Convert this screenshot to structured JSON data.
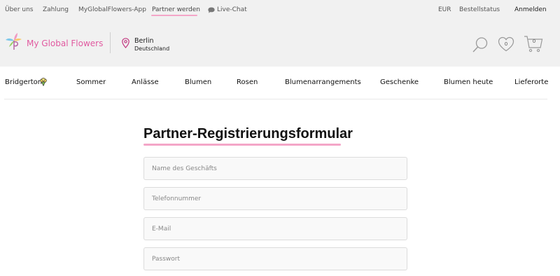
{
  "topbar": {
    "links": [
      "Über uns",
      "Zahlung",
      "MyGlobalFlowers-App",
      "Partner werden",
      "Live-Chat"
    ],
    "currency": "EUR",
    "order_status": "Bestellstatus",
    "login": "Anmelden"
  },
  "header": {
    "logo_text": "My Global Flowers",
    "location": {
      "city": "Berlin",
      "country": "Deutschland"
    },
    "wishlist_count": "0",
    "cart_count": "0"
  },
  "nav": {
    "items": [
      "Bridgerton",
      "Sommer",
      "Anlässe",
      "Blumen",
      "Rosen",
      "Blumenarrangements",
      "Geschenke",
      "Blumen heute",
      "Lieferorte"
    ]
  },
  "form": {
    "title": "Partner-Registrierungsformular",
    "fields": [
      {
        "placeholder": "Name des Geschäfts"
      },
      {
        "placeholder": "Telefonnummer"
      },
      {
        "placeholder": "E-Mail"
      },
      {
        "placeholder": "Passwort"
      }
    ]
  },
  "colors": {
    "brand_pink": "#e15aa0",
    "accent_underline": "#f4a6c8",
    "header_bg": "#f1f1f1"
  }
}
